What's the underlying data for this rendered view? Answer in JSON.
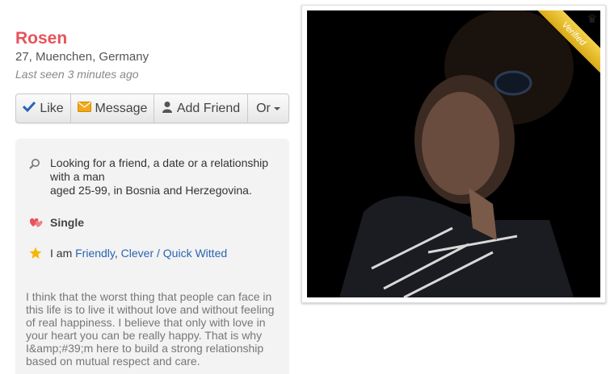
{
  "profile": {
    "name": "Rosen",
    "location": "27, Muenchen, Germany",
    "last_seen": "Last seen 3 minutes ago"
  },
  "actions": {
    "like": "Like",
    "message": "Message",
    "add_friend": "Add Friend",
    "or": "Or"
  },
  "info": {
    "looking_for_line1": "Looking for a friend, a date or a relationship",
    "looking_for_line2": "with a man",
    "looking_for_line3": "aged 25-99, in Bosnia and Herzegovina.",
    "status": "Single",
    "traits_prefix": "I am",
    "trait_1": "Friendly",
    "trait_sep": ",",
    "trait_2": "Clever / Quick Witted"
  },
  "bio": {
    "line1": "I think that the worst thing that people can face in",
    "line2": "this life is to live it without love and without feeling",
    "line3": "of real happiness. I believe that only with love in",
    "line4": "your heart you can be really happy. That is why",
    "line5": "I&amp;#39;m here to build a strong relationship",
    "line6": "based on mutual respect and care."
  },
  "photo": {
    "badge": "Verified"
  },
  "icons": {
    "like": "check-icon",
    "message": "envelope-icon",
    "add_friend": "person-add-icon",
    "or": "caret-down-icon",
    "looking": "search-icon",
    "status": "hearts-icon",
    "traits": "star-icon",
    "badge": "crown-icon"
  },
  "colors": {
    "name": "#e8525a",
    "link": "#2a64b3",
    "like_check": "#2a64b3",
    "star": "#f5b800",
    "hearts": "#e8525a"
  }
}
